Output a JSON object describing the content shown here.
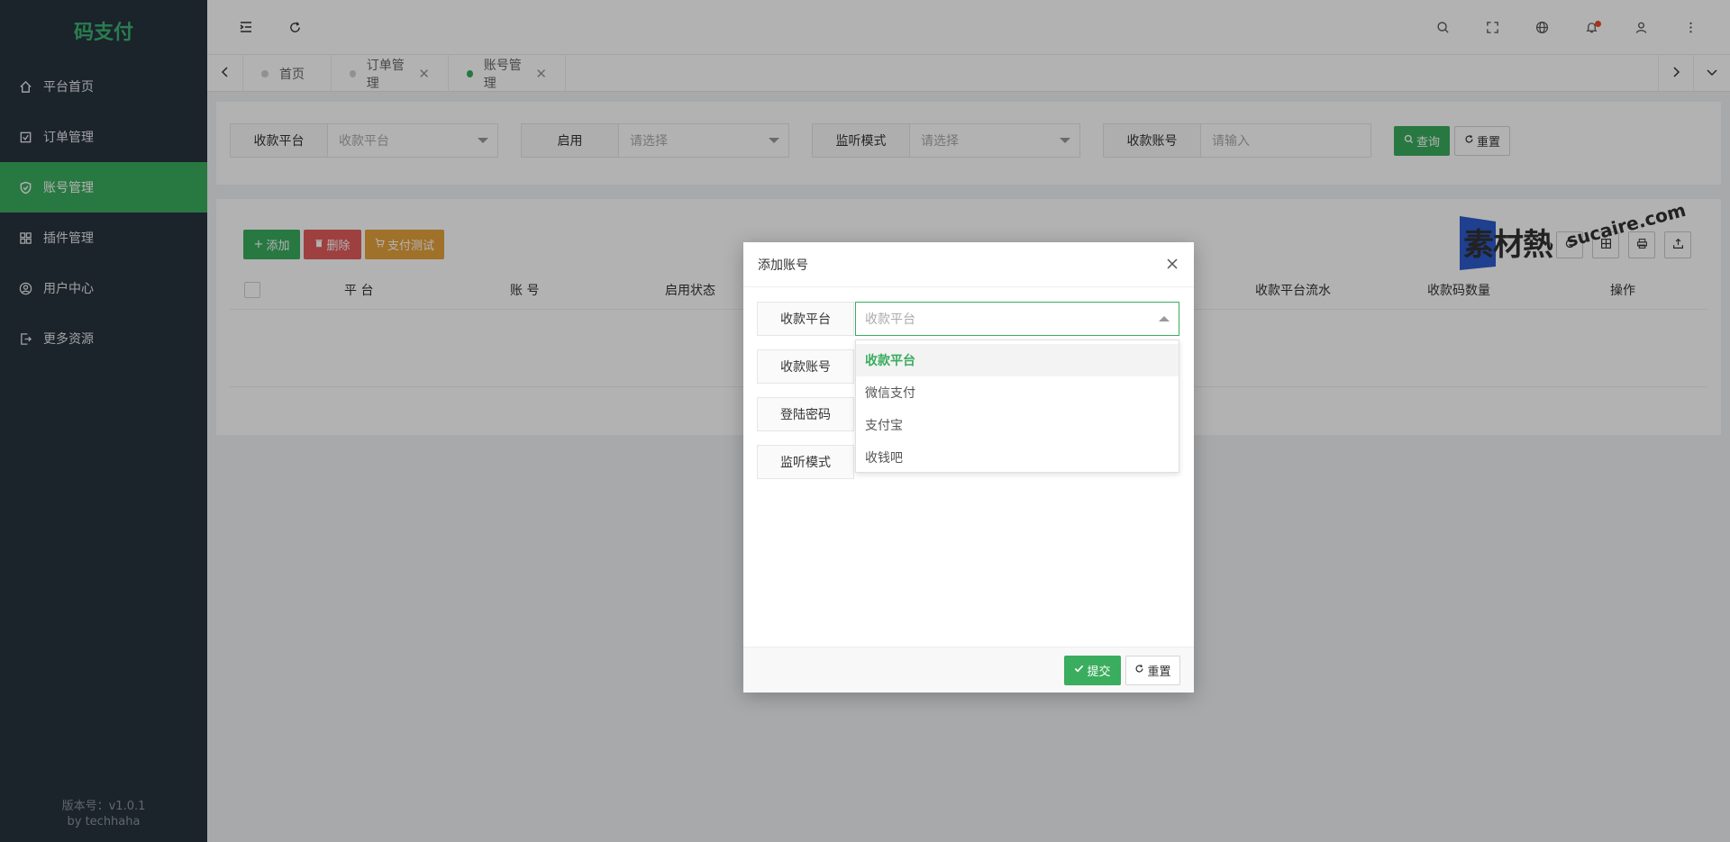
{
  "app": {
    "logo": "码支付",
    "version": "版本号：v1.0.1",
    "author": "by techhaha"
  },
  "sidebar": {
    "items": [
      {
        "label": "平台首页",
        "icon": "home-icon",
        "active": false
      },
      {
        "label": "订单管理",
        "icon": "checklist-icon",
        "active": false
      },
      {
        "label": "账号管理",
        "icon": "shield-icon",
        "active": true
      },
      {
        "label": "插件管理",
        "icon": "grid-icon",
        "active": false
      },
      {
        "label": "用户中心",
        "icon": "user-circle-icon",
        "active": false
      },
      {
        "label": "更多资源",
        "icon": "export-icon",
        "active": false
      }
    ]
  },
  "tabs": [
    {
      "label": "首页",
      "active": false,
      "closable": false
    },
    {
      "label": "订单管理",
      "active": false,
      "closable": true
    },
    {
      "label": "账号管理",
      "active": true,
      "closable": true
    }
  ],
  "filters": [
    {
      "label": "收款平台",
      "placeholder": "收款平台",
      "type": "select"
    },
    {
      "label": "启用",
      "placeholder": "请选择",
      "type": "select"
    },
    {
      "label": "监听模式",
      "placeholder": "请选择",
      "type": "select"
    },
    {
      "label": "收款账号",
      "placeholder": "请输入",
      "type": "input"
    }
  ],
  "filter_buttons": {
    "search": "查询",
    "reset": "重置"
  },
  "toolbar": {
    "add": "添加",
    "delete": "删除",
    "pay_test": "支付测试"
  },
  "table": {
    "columns": [
      "平 台",
      "账 号",
      "启用状态",
      "收款平台流水",
      "收款码数量",
      "操作"
    ]
  },
  "modal": {
    "title": "添加账号",
    "fields": [
      {
        "label": "收款平台"
      },
      {
        "label": "收款账号"
      },
      {
        "label": "登陆密码"
      },
      {
        "label": "监听模式"
      }
    ],
    "select_placeholder": "收款平台",
    "options": [
      "收款平台",
      "微信支付",
      "支付宝",
      "收钱吧"
    ],
    "submit": "提交",
    "reset": "重置"
  },
  "watermark": {
    "cn": "素材熱",
    "en": "sucaire.com"
  },
  "colors": {
    "primary": "#3aad5e",
    "sidebar": "#28333e",
    "danger": "#e35c5c",
    "warning": "#e6a23c",
    "badge": "#f04a2a"
  }
}
